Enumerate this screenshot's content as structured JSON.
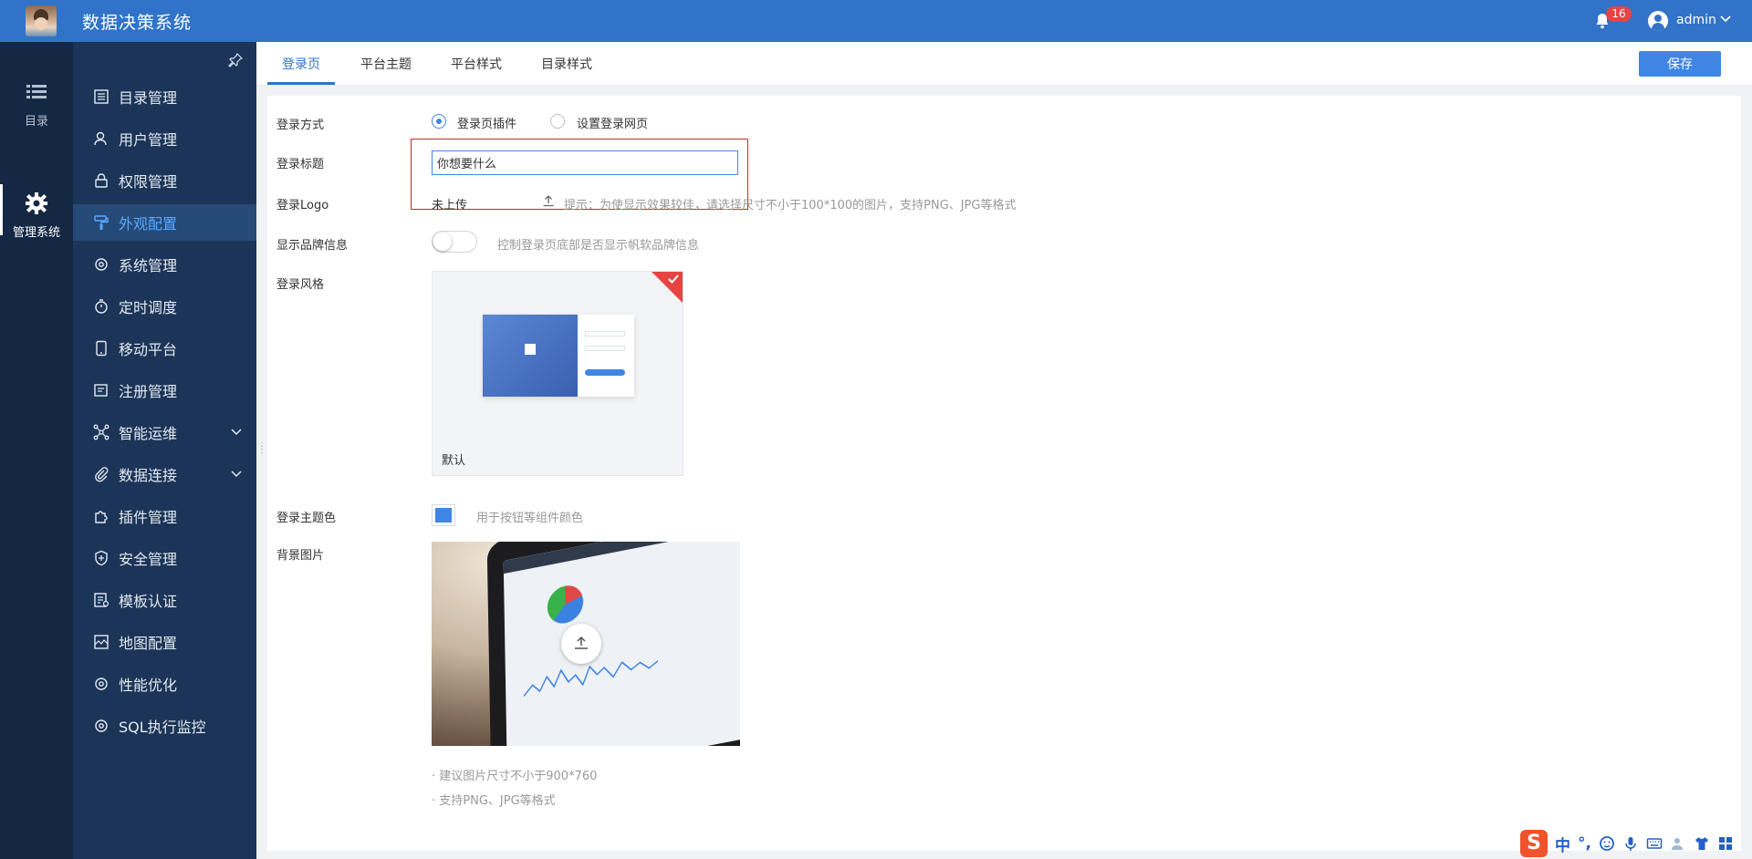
{
  "header": {
    "app_title": "数据决策系统",
    "notification_count": "16",
    "username": "admin"
  },
  "rail": {
    "items": [
      {
        "label": "目录",
        "icon": "list-icon"
      },
      {
        "label": "管理系统",
        "icon": "gear-icon"
      }
    ]
  },
  "menu": {
    "items": [
      {
        "label": "目录管理",
        "icon": "catalog-icon"
      },
      {
        "label": "用户管理",
        "icon": "user-icon"
      },
      {
        "label": "权限管理",
        "icon": "lock-icon"
      },
      {
        "label": "外观配置",
        "icon": "paint-roller-icon",
        "active": true
      },
      {
        "label": "系统管理",
        "icon": "settings-icon"
      },
      {
        "label": "定时调度",
        "icon": "timer-icon"
      },
      {
        "label": "移动平台",
        "icon": "mobile-icon"
      },
      {
        "label": "注册管理",
        "icon": "register-icon"
      },
      {
        "label": "智能运维",
        "icon": "network-icon",
        "expandable": true
      },
      {
        "label": "数据连接",
        "icon": "paperclip-icon",
        "expandable": true
      },
      {
        "label": "插件管理",
        "icon": "puzzle-icon"
      },
      {
        "label": "安全管理",
        "icon": "shield-icon"
      },
      {
        "label": "模板认证",
        "icon": "template-icon"
      },
      {
        "label": "地图配置",
        "icon": "map-icon"
      },
      {
        "label": "性能优化",
        "icon": "performance-icon"
      },
      {
        "label": "SQL执行监控",
        "icon": "monitor-icon"
      }
    ]
  },
  "tabs": [
    {
      "label": "登录页",
      "active": true
    },
    {
      "label": "平台主题"
    },
    {
      "label": "平台样式"
    },
    {
      "label": "目录样式"
    }
  ],
  "toolbar": {
    "save_label": "保存"
  },
  "form": {
    "login_method": {
      "label": "登录方式",
      "options": [
        "登录页插件",
        "设置登录网页"
      ],
      "selected": "登录页插件"
    },
    "login_title": {
      "label": "登录标题",
      "value": "你想要什么"
    },
    "login_logo": {
      "label": "登录Logo",
      "status": "未上传",
      "hint": "提示：为使显示效果较佳，请选择尺寸不小于100*100的图片，支持PNG、JPG等格式"
    },
    "brand_info": {
      "label": "显示品牌信息",
      "enabled": false,
      "hint": "控制登录页底部是否显示帆软品牌信息"
    },
    "login_style": {
      "label": "登录风格",
      "selected_name": "默认"
    },
    "theme_color": {
      "label": "登录主题色",
      "value": "#3f86e4",
      "hint": "用于按钮等组件颜色"
    },
    "background": {
      "label": "背景图片",
      "notes": [
        "· 建议图片尺寸不小于900*760",
        "· 支持PNG、JPG等格式"
      ]
    }
  },
  "ime": {
    "lang": "中",
    "punct": "°,"
  },
  "colors": {
    "header": "#3173c8",
    "rail": "#142844",
    "menu": "#1b3457",
    "accent": "#3f86e4",
    "highlight": "#e02020"
  }
}
